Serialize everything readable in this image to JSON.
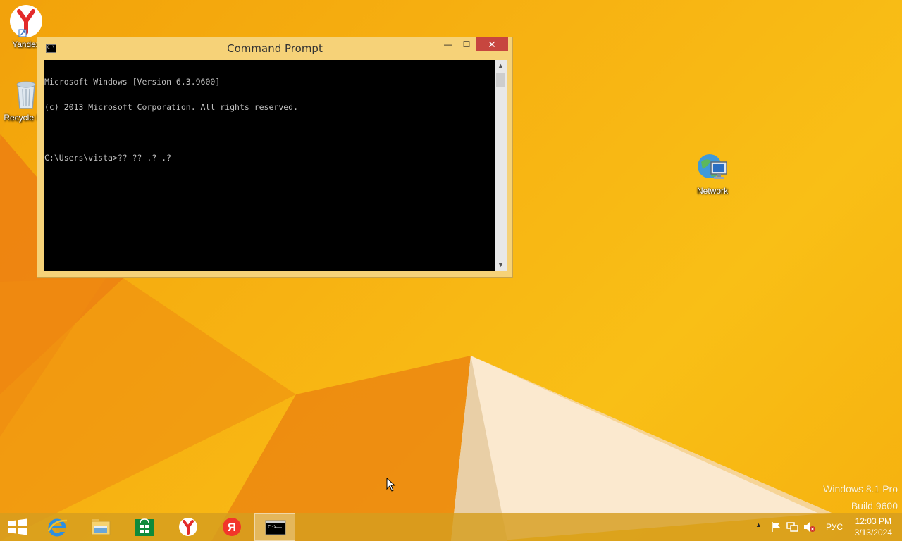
{
  "desktop": {
    "icons": [
      {
        "label": "Yandex",
        "icon": "yandex-browser-icon"
      },
      {
        "label": "Recycle Bin",
        "icon": "recycle-bin-icon"
      },
      {
        "label": "Network",
        "icon": "network-icon"
      }
    ],
    "watermark": {
      "line1": "Windows 8.1 Pro",
      "line2": "Build 9600"
    }
  },
  "window": {
    "title": "Command Prompt",
    "app_icon_text": "C:\\",
    "buttons": {
      "minimize": "—",
      "maximize": "☐",
      "close": "✕"
    },
    "console_lines": [
      "Microsoft Windows [Version 6.3.9600]",
      "(c) 2013 Microsoft Corporation. All rights reserved.",
      "",
      "C:\\Users\\vista>?? ?? .? .?"
    ]
  },
  "taskbar": {
    "items": [
      {
        "name": "start-button",
        "icon": "windows-logo-icon"
      },
      {
        "name": "internet-explorer",
        "icon": "internet-explorer-icon"
      },
      {
        "name": "file-explorer",
        "icon": "file-explorer-icon"
      },
      {
        "name": "store",
        "icon": "store-icon"
      },
      {
        "name": "yandex-browser",
        "icon": "yandex-browser-icon"
      },
      {
        "name": "yandex",
        "icon": "yandex-letter-icon",
        "text": "Я"
      },
      {
        "name": "command-prompt",
        "icon": "cmd-icon",
        "active": true
      }
    ],
    "tray": {
      "language": "РУС",
      "time": "12:03 PM",
      "date": "3/13/2024"
    }
  },
  "colors": {
    "accent": "#f7b212",
    "window_frame": "#f6d278",
    "close_button": "#c7463f",
    "console_bg": "#000000",
    "console_text": "#c0c0c0"
  }
}
